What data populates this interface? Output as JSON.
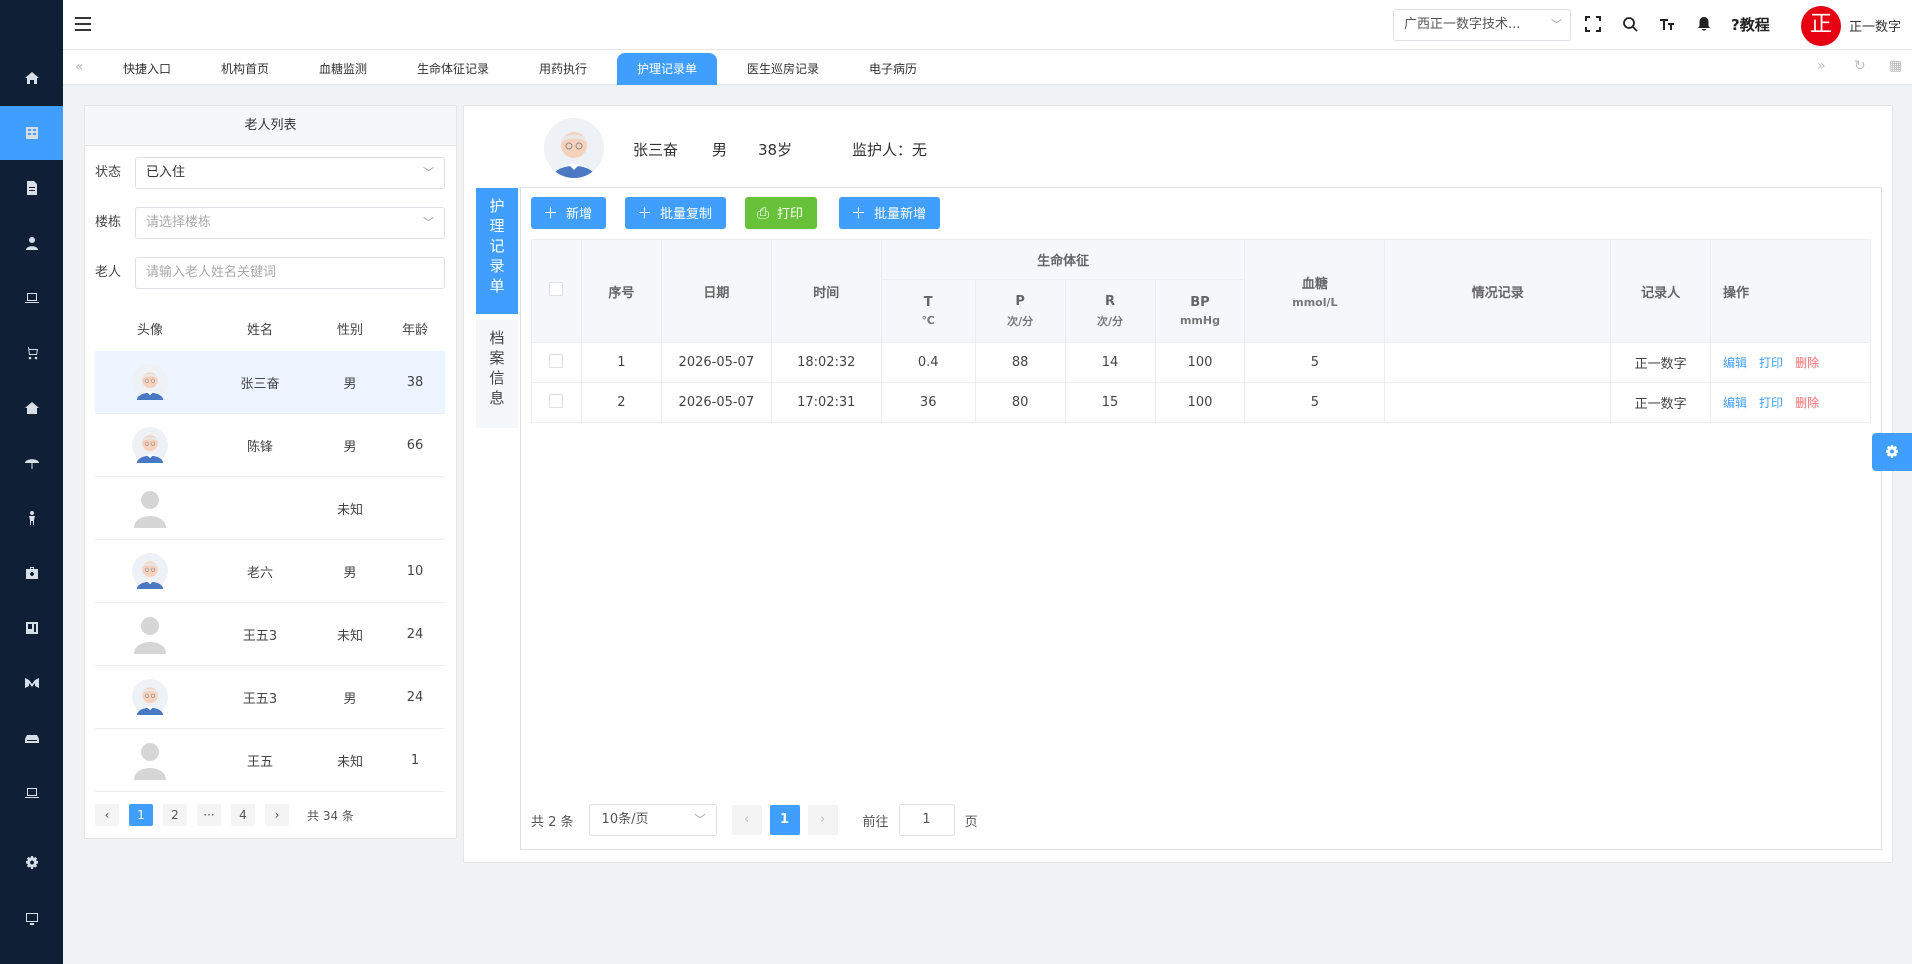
{
  "topbar": {
    "org_select": "广西正一数字技术...",
    "help_label": "?教程",
    "avatar_char": "正",
    "user_name": "正一数字",
    "accent": "#409eff"
  },
  "tabs": [
    "快捷入口",
    "机构首页",
    "血糖监测",
    "生命体征记录",
    "用药执行",
    "护理记录单",
    "医生巡房记录",
    "电子病历"
  ],
  "active_tab": "护理记录单",
  "left": {
    "title": "老人列表",
    "status_label": "状态",
    "status_value": "已入住",
    "building_label": "楼栋",
    "building_placeholder": "请选择楼栋",
    "elder_label": "老人",
    "elder_placeholder": "请输入老人姓名关键词",
    "columns": [
      "头像",
      "姓名",
      "性别",
      "年龄"
    ],
    "rows": [
      {
        "name": "张三奋",
        "sex": "男",
        "age": "38",
        "avatar": "elder-avatar"
      },
      {
        "name": "陈锋",
        "sex": "男",
        "age": "66",
        "avatar": "elder-avatar"
      },
      {
        "name": "",
        "sex": "未知",
        "age": "",
        "avatar": "default-avatar"
      },
      {
        "name": "老六",
        "sex": "男",
        "age": "10",
        "avatar": "elder-avatar"
      },
      {
        "name": "王五3",
        "sex": "未知",
        "age": "24",
        "avatar": "default-avatar"
      },
      {
        "name": "王五3",
        "sex": "男",
        "age": "24",
        "avatar": "elder-avatar"
      },
      {
        "name": "王五",
        "sex": "未知",
        "age": "1",
        "avatar": "default-avatar"
      }
    ],
    "pager": {
      "prev": "‹",
      "pages": [
        "1",
        "2",
        "···",
        "4"
      ],
      "next": "›",
      "total": "共 34 条"
    }
  },
  "patient": {
    "name": "张三奋",
    "sex": "男",
    "age": "38岁",
    "guardian": "监护人：无"
  },
  "vtabs": {
    "record": "护理记录单",
    "archive": "档案信息"
  },
  "buttons": {
    "add": "新增",
    "batch_copy": "批量复制",
    "print": "打印",
    "batch_add": "批量新增"
  },
  "table": {
    "headers": {
      "index": "序号",
      "date": "日期",
      "time": "时间",
      "vitals": "生命体征",
      "T": "T",
      "T_unit": "℃",
      "P": "P",
      "P_unit": "次/分",
      "R": "R",
      "R_unit": "次/分",
      "BP": "BP",
      "BP_unit": "mmHg",
      "glucose": "血糖",
      "glucose_unit": "mmol/L",
      "note": "情况记录",
      "recorder": "记录人",
      "ops": "操作"
    },
    "rows": [
      {
        "index": "1",
        "date": "2026-05-07",
        "time": "18:02:32",
        "T": "0.4",
        "P": "88",
        "R": "14",
        "BP": "100",
        "glucose": "5",
        "note": "",
        "recorder": "正一数字"
      },
      {
        "index": "2",
        "date": "2026-05-07",
        "time": "17:02:31",
        "T": "36",
        "P": "80",
        "R": "15",
        "BP": "100",
        "glucose": "5",
        "note": "",
        "recorder": "正一数字"
      }
    ],
    "ops": {
      "edit": "编辑",
      "print": "打印",
      "delete": "删除"
    }
  },
  "pager": {
    "total": "共 2 条",
    "size": "10条/页",
    "prev": "‹",
    "current": "1",
    "next": "›",
    "goto_label": "前往",
    "goto_value": "1",
    "page_suffix": "页"
  }
}
